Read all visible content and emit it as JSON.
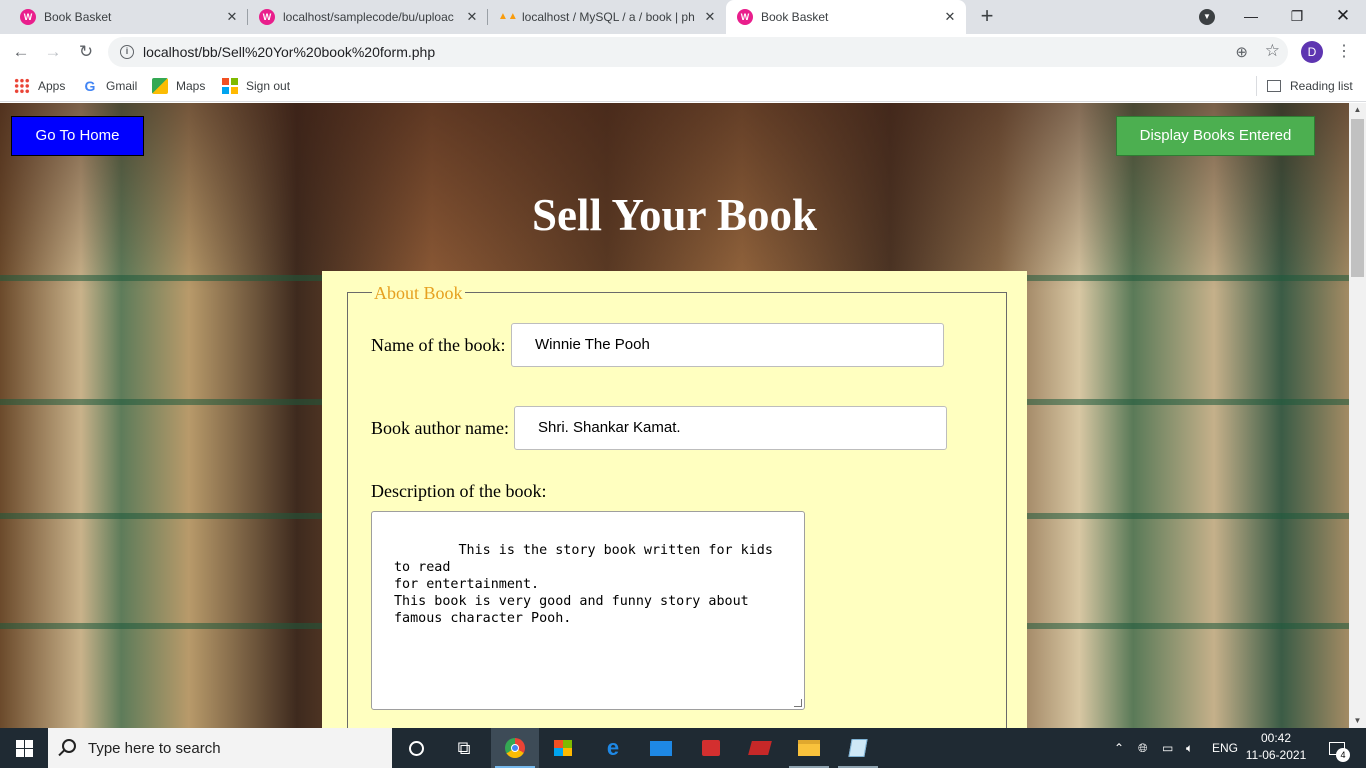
{
  "browser": {
    "tabs": [
      {
        "title": "Book Basket",
        "active": false
      },
      {
        "title": "localhost/samplecode/bu/uploac",
        "active": false
      },
      {
        "title": "localhost / MySQL / a / book | ph",
        "active": false
      },
      {
        "title": "Book Basket",
        "active": true
      }
    ],
    "url": "localhost/bb/Sell%20Yor%20book%20form.php",
    "profile_initial": "D",
    "bookmarks": [
      {
        "label": "Apps",
        "icon": "apps-grid-icon"
      },
      {
        "label": "Gmail",
        "icon": "google-icon"
      },
      {
        "label": "Maps",
        "icon": "maps-icon"
      },
      {
        "label": "Sign out",
        "icon": "microsoft-icon"
      }
    ],
    "reading_list": "Reading list"
  },
  "page": {
    "home_button": "Go To Home",
    "display_button": "Display Books Entered",
    "title": "Sell Your Book",
    "form": {
      "legend": "About Book",
      "name_label": "Name of the book:",
      "name_value": "Winnie The Pooh",
      "author_label": "Book author name:",
      "author_value": "Shri. Shankar Kamat.",
      "description_label": "Description of the book:",
      "description_value": "This is the story book written for kids to read\nfor entertainment.\nThis book is very good and funny story about\nfamous character Pooh."
    }
  },
  "taskbar": {
    "search_placeholder": "Type here to search",
    "language": "ENG",
    "time": "00:42",
    "date": "11-06-2021",
    "notification_count": "4"
  },
  "colors": {
    "home_button": "#0000ff",
    "display_button": "#4caf50",
    "form_background": "#ffffc0",
    "legend": "#e6a020"
  }
}
